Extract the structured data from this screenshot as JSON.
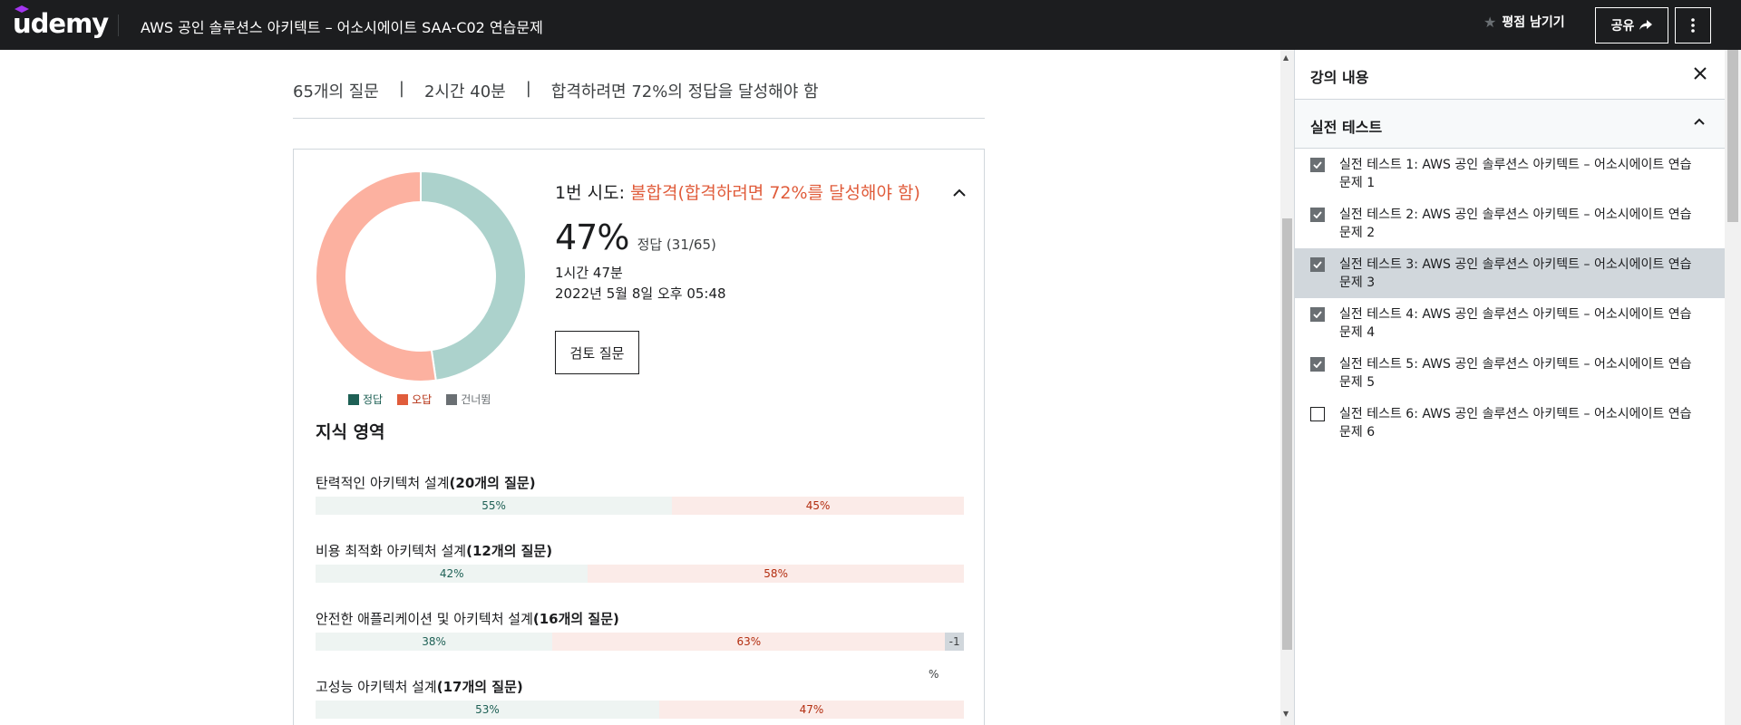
{
  "header": {
    "logo_text": "udemy",
    "course_title": "AWS 공인 솔루션스 아키텍트 – 어소시에이트 SAA-C02 연습문제",
    "rate_label": "평점 남기기",
    "share_label": "공유",
    "more_icon": "kebab-icon"
  },
  "summary": {
    "questions": "65개의 질문",
    "duration": "2시간 40분",
    "pass_requirement": "합격하려면 72%의 정답을 달성해야 함",
    "separator": "|"
  },
  "result": {
    "attempt_label": "1번 시도:",
    "status": "불합격(합격하려면 72%를 달성해야 함)",
    "score_percent": "47%",
    "score_detail": "정답 (31/65)",
    "time_taken": "1시간 47분",
    "date": "2022년 5월 8일 오후 05:48",
    "review_button": "검토 질문"
  },
  "legend": {
    "correct": "정답",
    "wrong": "오답",
    "skipped": "건너뜀"
  },
  "colors": {
    "correct": "#acd2cc",
    "wrong": "#fcb1a0",
    "skip": "#6a6f73",
    "fail_text": "#e05c3b",
    "header_bg": "#1c1d1f",
    "active_item": "#d1d7dc"
  },
  "chart_data": {
    "type": "pie",
    "donut": true,
    "labels": [
      "정답",
      "오답",
      "건너뜀"
    ],
    "values": [
      31,
      34,
      0
    ]
  },
  "knowledge_area": {
    "title": "지식 영역",
    "domains": [
      {
        "name": "탄력적인 아키텍처 설계",
        "count": "(20개의 질문)",
        "correct": 55,
        "wrong": 45,
        "skip": 0,
        "correct_label": "55%",
        "wrong_label": "45%",
        "skip_label": ""
      },
      {
        "name": "비용 최적화 아키텍처 설계",
        "count": "(12개의 질문)",
        "correct": 42,
        "wrong": 58,
        "skip": 0,
        "correct_label": "42%",
        "wrong_label": "58%",
        "skip_label": ""
      },
      {
        "name": "안전한 애플리케이션 및 아키텍처 설계",
        "count": "(16개의 질문)",
        "correct": 38,
        "wrong": 63,
        "skip": 1,
        "correct_label": "38%",
        "wrong_label": "63%",
        "skip_label": "-1"
      },
      {
        "name": "고성능 아키텍처 설계",
        "count": "(17개의 질문)",
        "correct": 53,
        "wrong": 47,
        "skip": 0,
        "correct_label": "53%",
        "wrong_label": "47%",
        "skip_label": ""
      }
    ],
    "skip_unit": "%"
  },
  "sidebar": {
    "title": "강의 내용",
    "section_title": "실전 테스트",
    "items": [
      {
        "label": "실전 테스트 1: AWS 공인 솔루션스 아키텍트 – 어소시에이트 연습문제 1",
        "checked": true,
        "active": false
      },
      {
        "label": "실전 테스트 2: AWS 공인 솔루션스 아키텍트 – 어소시에이트 연습문제 2",
        "checked": true,
        "active": false
      },
      {
        "label": "실전 테스트 3: AWS 공인 솔루션스 아키텍트 – 어소시에이트 연습문제 3",
        "checked": true,
        "active": true
      },
      {
        "label": "실전 테스트 4: AWS 공인 솔루션스 아키텍트 – 어소시에이트 연습문제 4",
        "checked": true,
        "active": false
      },
      {
        "label": "실전 테스트 5: AWS 공인 솔루션스 아키텍트 – 어소시에이트 연습문제 5",
        "checked": true,
        "active": false
      },
      {
        "label": "실전 테스트 6: AWS 공인 솔루션스 아키텍트 – 어소시에이트 연습문제 6",
        "checked": false,
        "active": false
      }
    ]
  }
}
